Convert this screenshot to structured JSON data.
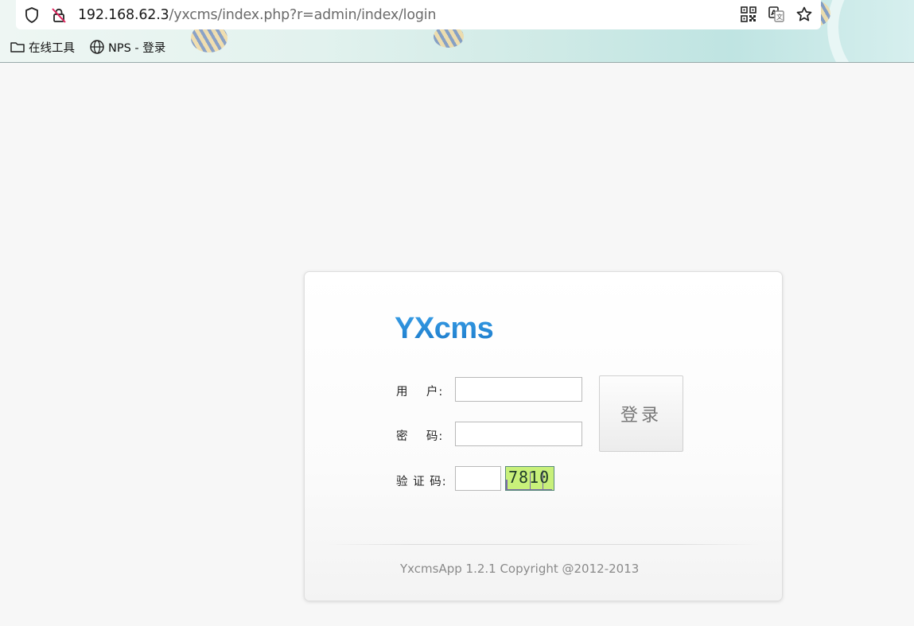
{
  "browser": {
    "url_host": "192.168.62.3",
    "url_path": "/yxcms/index.php?r=admin/index/login",
    "icons": {
      "shield": "shield-icon",
      "not_secure": "not-secure-lock-icon",
      "qr": "qr-code-icon",
      "translate": "translate-icon",
      "bookmark_star": "star-icon"
    },
    "bookmarks": [
      {
        "label": "在线工具",
        "icon": "folder-icon"
      },
      {
        "label": "NPS - 登录",
        "icon": "globe-icon"
      }
    ]
  },
  "login": {
    "logo": "YXcms",
    "username_label": "用    户:",
    "password_label": "密    码:",
    "captcha_label": "验 证 码:",
    "username_value": "",
    "password_value": "",
    "captcha_value": "",
    "captcha_image_text": "7810",
    "submit_label": "登录",
    "footer": "YxcmsApp 1.2.1 Copyright @2012-2013"
  },
  "colors": {
    "logo": "#1f8ad6",
    "captcha_bg": "#c8f07a",
    "page_bg": "#f7f7f7"
  }
}
